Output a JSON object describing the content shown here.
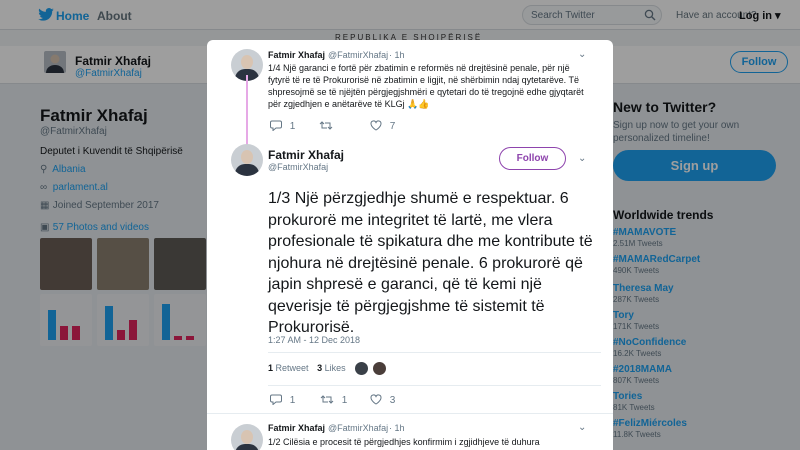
{
  "nav": {
    "home": "Home",
    "about": "About",
    "search_placeholder": "Search Twitter",
    "account_question": "Have an account?",
    "login": "Log in ▾"
  },
  "banner": "REPUBLIKA E SHQIPËRISË",
  "profile": {
    "name": "Fatmir Xhafaj",
    "handle": "@FatmirXhafaj",
    "follow": "Follow",
    "bio": "Deputet i Kuvendit të Shqipërisë",
    "location": "Albania",
    "link": "parlament.al",
    "joined": "Joined September 2017",
    "photos": "57 Photos and videos"
  },
  "sidebar_right": {
    "cta_title": "New to Twitter?",
    "cta_sub": "Sign up now to get your own personalized timeline!",
    "signup": "Sign up",
    "trends_title": "Worldwide trends",
    "trends": [
      {
        "tag": "#MAMAVOTE",
        "count": "2.51M Tweets"
      },
      {
        "tag": "#MAMARedCarpet",
        "count": "490K Tweets"
      },
      {
        "tag": "Theresa May",
        "count": "287K Tweets"
      },
      {
        "tag": "Tory",
        "count": "171K Tweets"
      },
      {
        "tag": "#NoConfidence",
        "count": "16.2K Tweets"
      },
      {
        "tag": "#2018MAMA",
        "count": "807K Tweets"
      },
      {
        "tag": "Tories",
        "count": "81K Tweets"
      },
      {
        "tag": "#FelizMiércoles",
        "count": "11.8K Tweets"
      }
    ]
  },
  "modal": {
    "prev_tweet": {
      "name": "Fatmir Xhafaj",
      "handle": "@FatmirXhafaj",
      "time": "· 1h",
      "text": "1/4 Një garanci e fortë për zbatimin e reformës në drejtësinë penale, për një fytyrë të re të Prokurorisë në zbatimin e ligjit, në shërbimin ndaj qytetarëve. Të shpresojmë se të njëjtën përgjegjshmëri e qytetari do të tregojnë edhe gjyqtarët për zgjedhjen e anëtarëve të KLGj 🙏👍",
      "replies": "1",
      "retweets": "",
      "likes": "7"
    },
    "main_tweet": {
      "name": "Fatmir Xhafaj",
      "handle": "@FatmirXhafaj",
      "follow": "Follow",
      "text": "1/3 Një përzgjedhje shumë e respektuar. 6 prokurorë me integritet të lartë, me vlera profesionale të spikatura dhe me kontribute të njohura në drejtësinë penale. 6 prokurorë që japin shpresë e garanci, që të kemi një qeverisje të përgjegjshme të sistemit të Prokurorisë.",
      "time": "1:27 AM - 12 Dec 2018",
      "retweet_count": "1",
      "retweet_label": "Retweet",
      "like_count": "3",
      "like_label": "Likes",
      "replies": "1",
      "retweets": "1",
      "likes": "3"
    },
    "next_tweet": {
      "name": "Fatmir Xhafaj",
      "handle": "@FatmirXhafaj",
      "time": "· 1h",
      "text": "1/2 Cilësia e procesit të përgjedhjes konfirmim i zgjidhjeve të duhura"
    }
  },
  "colors": {
    "accent": "#1da1f2",
    "follow_purple": "#8e44ad",
    "thread_line": "#e6a9e6"
  }
}
